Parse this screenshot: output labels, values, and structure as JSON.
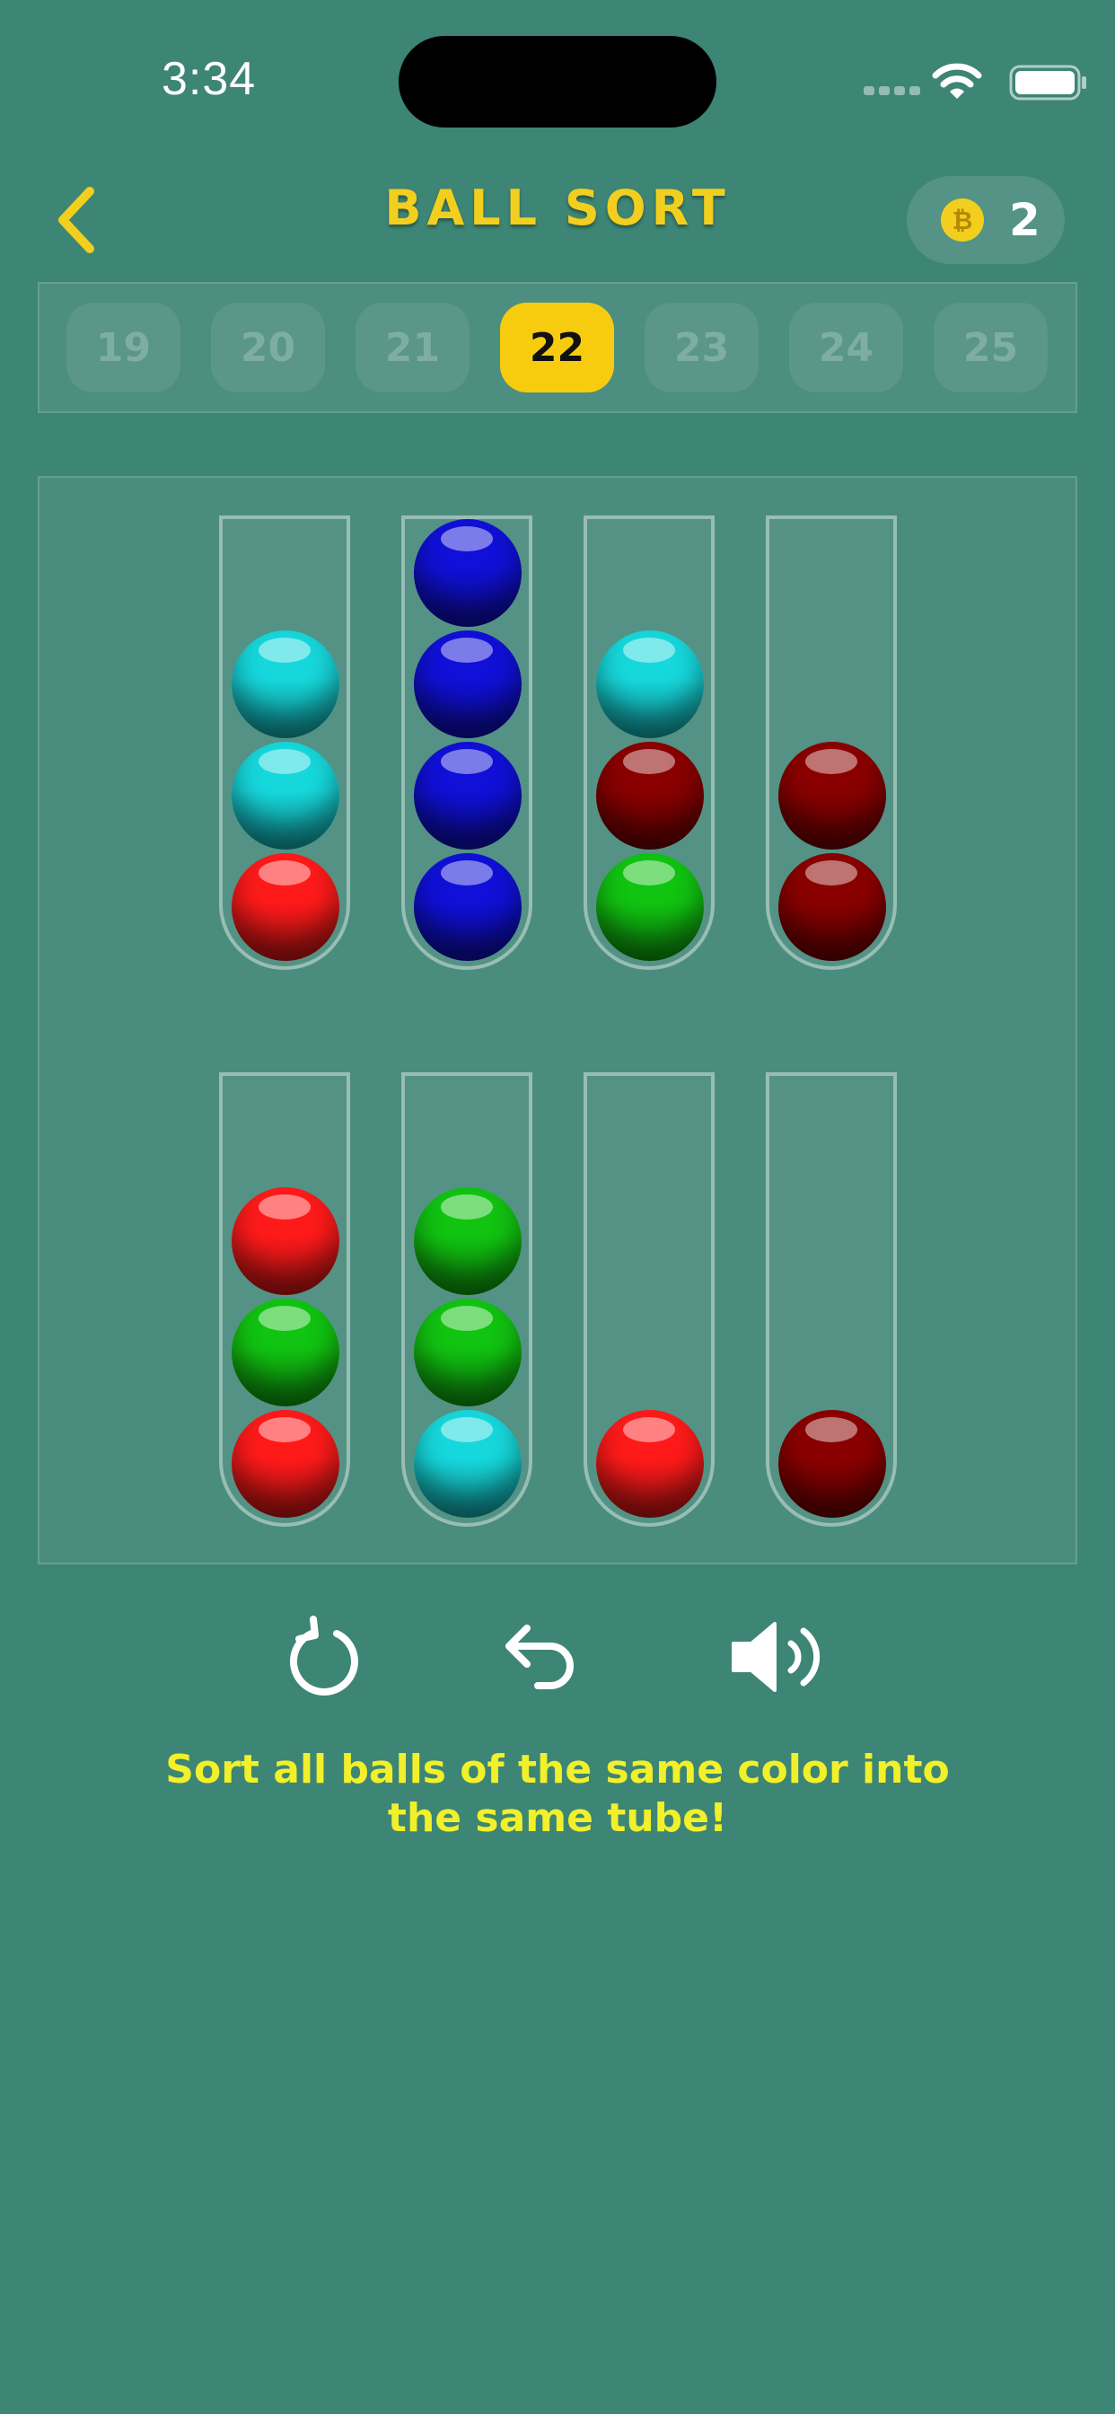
{
  "status_bar": {
    "time": "3:34"
  },
  "header": {
    "title": "BALL SORT",
    "coins": "2",
    "coin_symbol": "₿"
  },
  "levels": {
    "items": [
      "19",
      "20",
      "21",
      "22",
      "23",
      "24",
      "25"
    ],
    "current": "22"
  },
  "colors": {
    "background": "#3d8575",
    "accent": "#f8cc0e",
    "hint_text": "#f1f02a",
    "balls": {
      "cyan": "#16d8dc",
      "blue": "#1010d8",
      "red": "#ff1a1a",
      "darkred": "#8a0000",
      "green": "#11c411"
    }
  },
  "board": {
    "tube_capacity": 4,
    "tubes": [
      {
        "balls": [
          "red",
          "cyan",
          "cyan"
        ]
      },
      {
        "balls": [
          "blue",
          "blue",
          "blue",
          "blue"
        ]
      },
      {
        "balls": [
          "green",
          "darkred",
          "cyan"
        ]
      },
      {
        "balls": [
          "darkred",
          "darkred"
        ]
      },
      {
        "balls": [
          "red",
          "green",
          "red"
        ]
      },
      {
        "balls": [
          "cyan",
          "green",
          "green"
        ]
      },
      {
        "balls": [
          "red"
        ]
      },
      {
        "balls": [
          "darkred"
        ]
      }
    ]
  },
  "controls": {
    "restart_icon": "restart-icon",
    "undo_icon": "undo-icon",
    "sound_icon": "sound-on-icon"
  },
  "hint": "Sort all balls of the same color into the same tube!"
}
